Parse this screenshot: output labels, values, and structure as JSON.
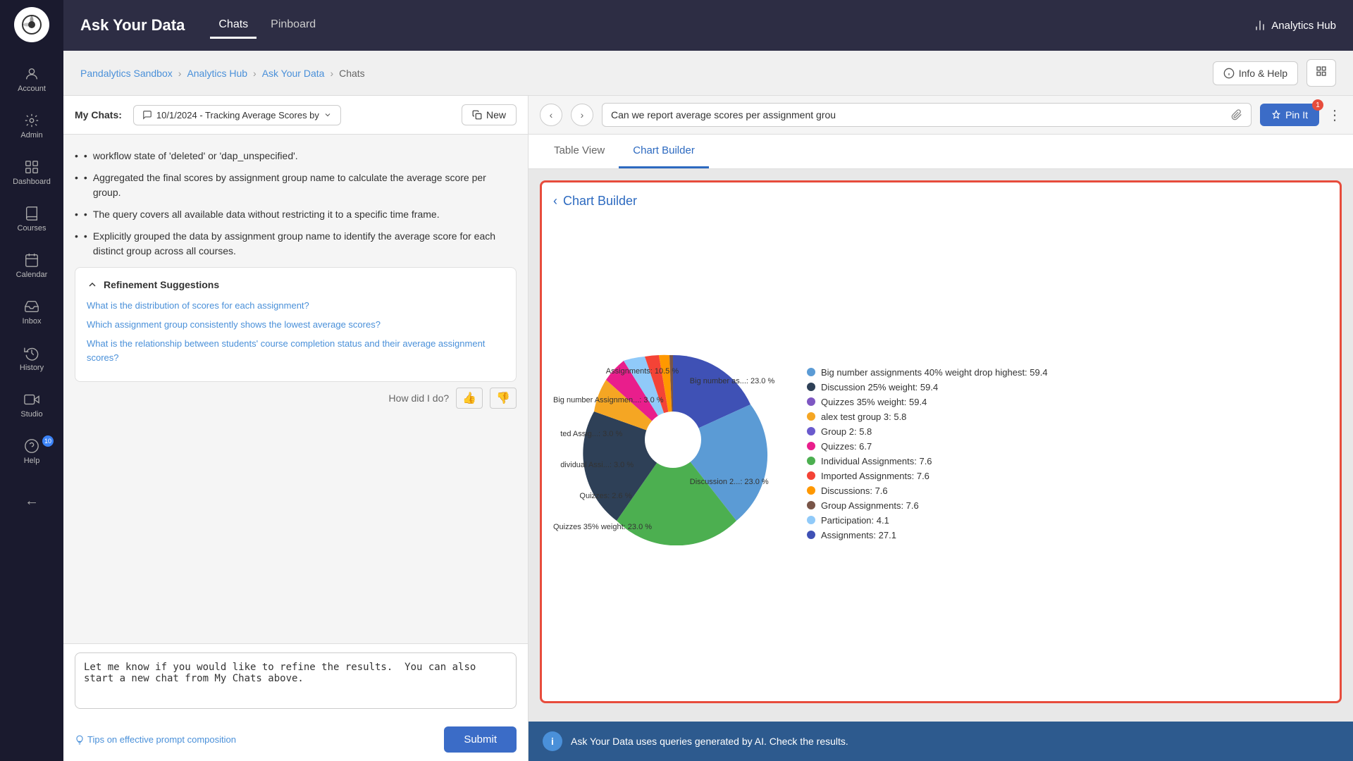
{
  "sidebar": {
    "logo_alt": "App Logo",
    "items": [
      {
        "id": "account",
        "label": "Account",
        "icon": "account"
      },
      {
        "id": "admin",
        "label": "Admin",
        "icon": "admin"
      },
      {
        "id": "dashboard",
        "label": "Dashboard",
        "icon": "dashboard"
      },
      {
        "id": "courses",
        "label": "Courses",
        "icon": "courses"
      },
      {
        "id": "calendar",
        "label": "Calendar",
        "icon": "calendar"
      },
      {
        "id": "inbox",
        "label": "Inbox",
        "icon": "inbox"
      },
      {
        "id": "history",
        "label": "History",
        "icon": "history"
      },
      {
        "id": "studio",
        "label": "Studio",
        "icon": "studio"
      },
      {
        "id": "help",
        "label": "Help",
        "icon": "help",
        "badge": "10"
      }
    ],
    "back_label": "←"
  },
  "topbar": {
    "title": "Ask Your Data",
    "nav_chats": "Chats",
    "nav_pinboard": "Pinboard",
    "analytics_hub": "Analytics Hub"
  },
  "breadcrumb": {
    "items": [
      {
        "label": "Pandalytics Sandbox",
        "active": true
      },
      {
        "label": "Analytics Hub",
        "active": true
      },
      {
        "label": "Ask Your Data",
        "active": true
      },
      {
        "label": "Chats",
        "active": false
      }
    ],
    "info_help_label": "Info & Help"
  },
  "chat": {
    "my_chats_label": "My Chats:",
    "current_chat": "10/1/2024 - Tracking Average Scores by",
    "new_btn": "New",
    "bullets": [
      "workflow state of 'deleted' or 'dap_unspecified'.",
      "Aggregated the final scores by assignment group name to calculate the average score per group.",
      "The query covers all available data without restricting it to a specific time frame.",
      "Explicitly grouped the data by assignment group name to identify the average score for each distinct group across all courses."
    ],
    "refinement_title": "Refinement Suggestions",
    "refinement_links": [
      "What is the distribution of scores for each assignment?",
      "Which assignment group consistently shows the lowest average scores?",
      "What is the relationship between students' course completion status and their average assignment scores?"
    ],
    "feedback_label": "How did I do?",
    "input_placeholder": "Let me know if you would like to refine the results.  You can also start a new chat from My Chats above.",
    "tips_label": "Tips on effective prompt composition",
    "submit_label": "Submit"
  },
  "right_panel": {
    "query_text": "Can we report average scores per assignment grou",
    "pin_label": "Pin It",
    "pin_count": "1",
    "tab_table": "Table View",
    "tab_chart": "Chart Builder",
    "chart_title": "Chart Builder",
    "legend": [
      {
        "label": "Big number assignments 40% weight drop highest: 59.4",
        "color": "#5b9bd5"
      },
      {
        "label": "Discussion 25% weight: 59.4",
        "color": "#2e4057"
      },
      {
        "label": "Quizzes 35% weight: 59.4",
        "color": "#7e57c2"
      },
      {
        "label": "alex test group 3: 5.8",
        "color": "#f5a623"
      },
      {
        "label": "Group 2: 5.8",
        "color": "#6a5acd"
      },
      {
        "label": "Quizzes: 6.7",
        "color": "#e91e8c"
      },
      {
        "label": "Individual Assignments: 7.6",
        "color": "#4caf50"
      },
      {
        "label": "Imported Assignments: 7.6",
        "color": "#f44336"
      },
      {
        "label": "Discussions: 7.6",
        "color": "#ff9800"
      },
      {
        "label": "Group Assignments: 7.6",
        "color": "#795548"
      },
      {
        "label": "Participation: 4.1",
        "color": "#90caf9"
      },
      {
        "label": "Assignments: 27.1",
        "color": "#3f51b5"
      }
    ],
    "pie_labels": [
      {
        "text": "Assignments: 10.5 %",
        "top": "14%",
        "left": "22%"
      },
      {
        "text": "Big number Assignmen...: 3.0 %",
        "top": "28%",
        "left": "1%"
      },
      {
        "text": "ted Assig...: 3.0 %",
        "top": "44%",
        "left": "5%"
      },
      {
        "text": "dividual Assi...: 3.0 %",
        "top": "56%",
        "left": "5%"
      },
      {
        "text": "Quizzes: 2.6 %",
        "top": "68%",
        "left": "13%"
      },
      {
        "text": "Quizzes 35% weight: 23.0 %",
        "top": "80%",
        "left": "2%"
      },
      {
        "text": "Big number as...: 23.0 %",
        "top": "22%",
        "left": "58%"
      },
      {
        "text": "Discussion 2...: 23.0 %",
        "top": "62%",
        "left": "58%"
      }
    ],
    "bottom_notice": "Ask Your Data uses queries generated by AI. Check the results."
  }
}
